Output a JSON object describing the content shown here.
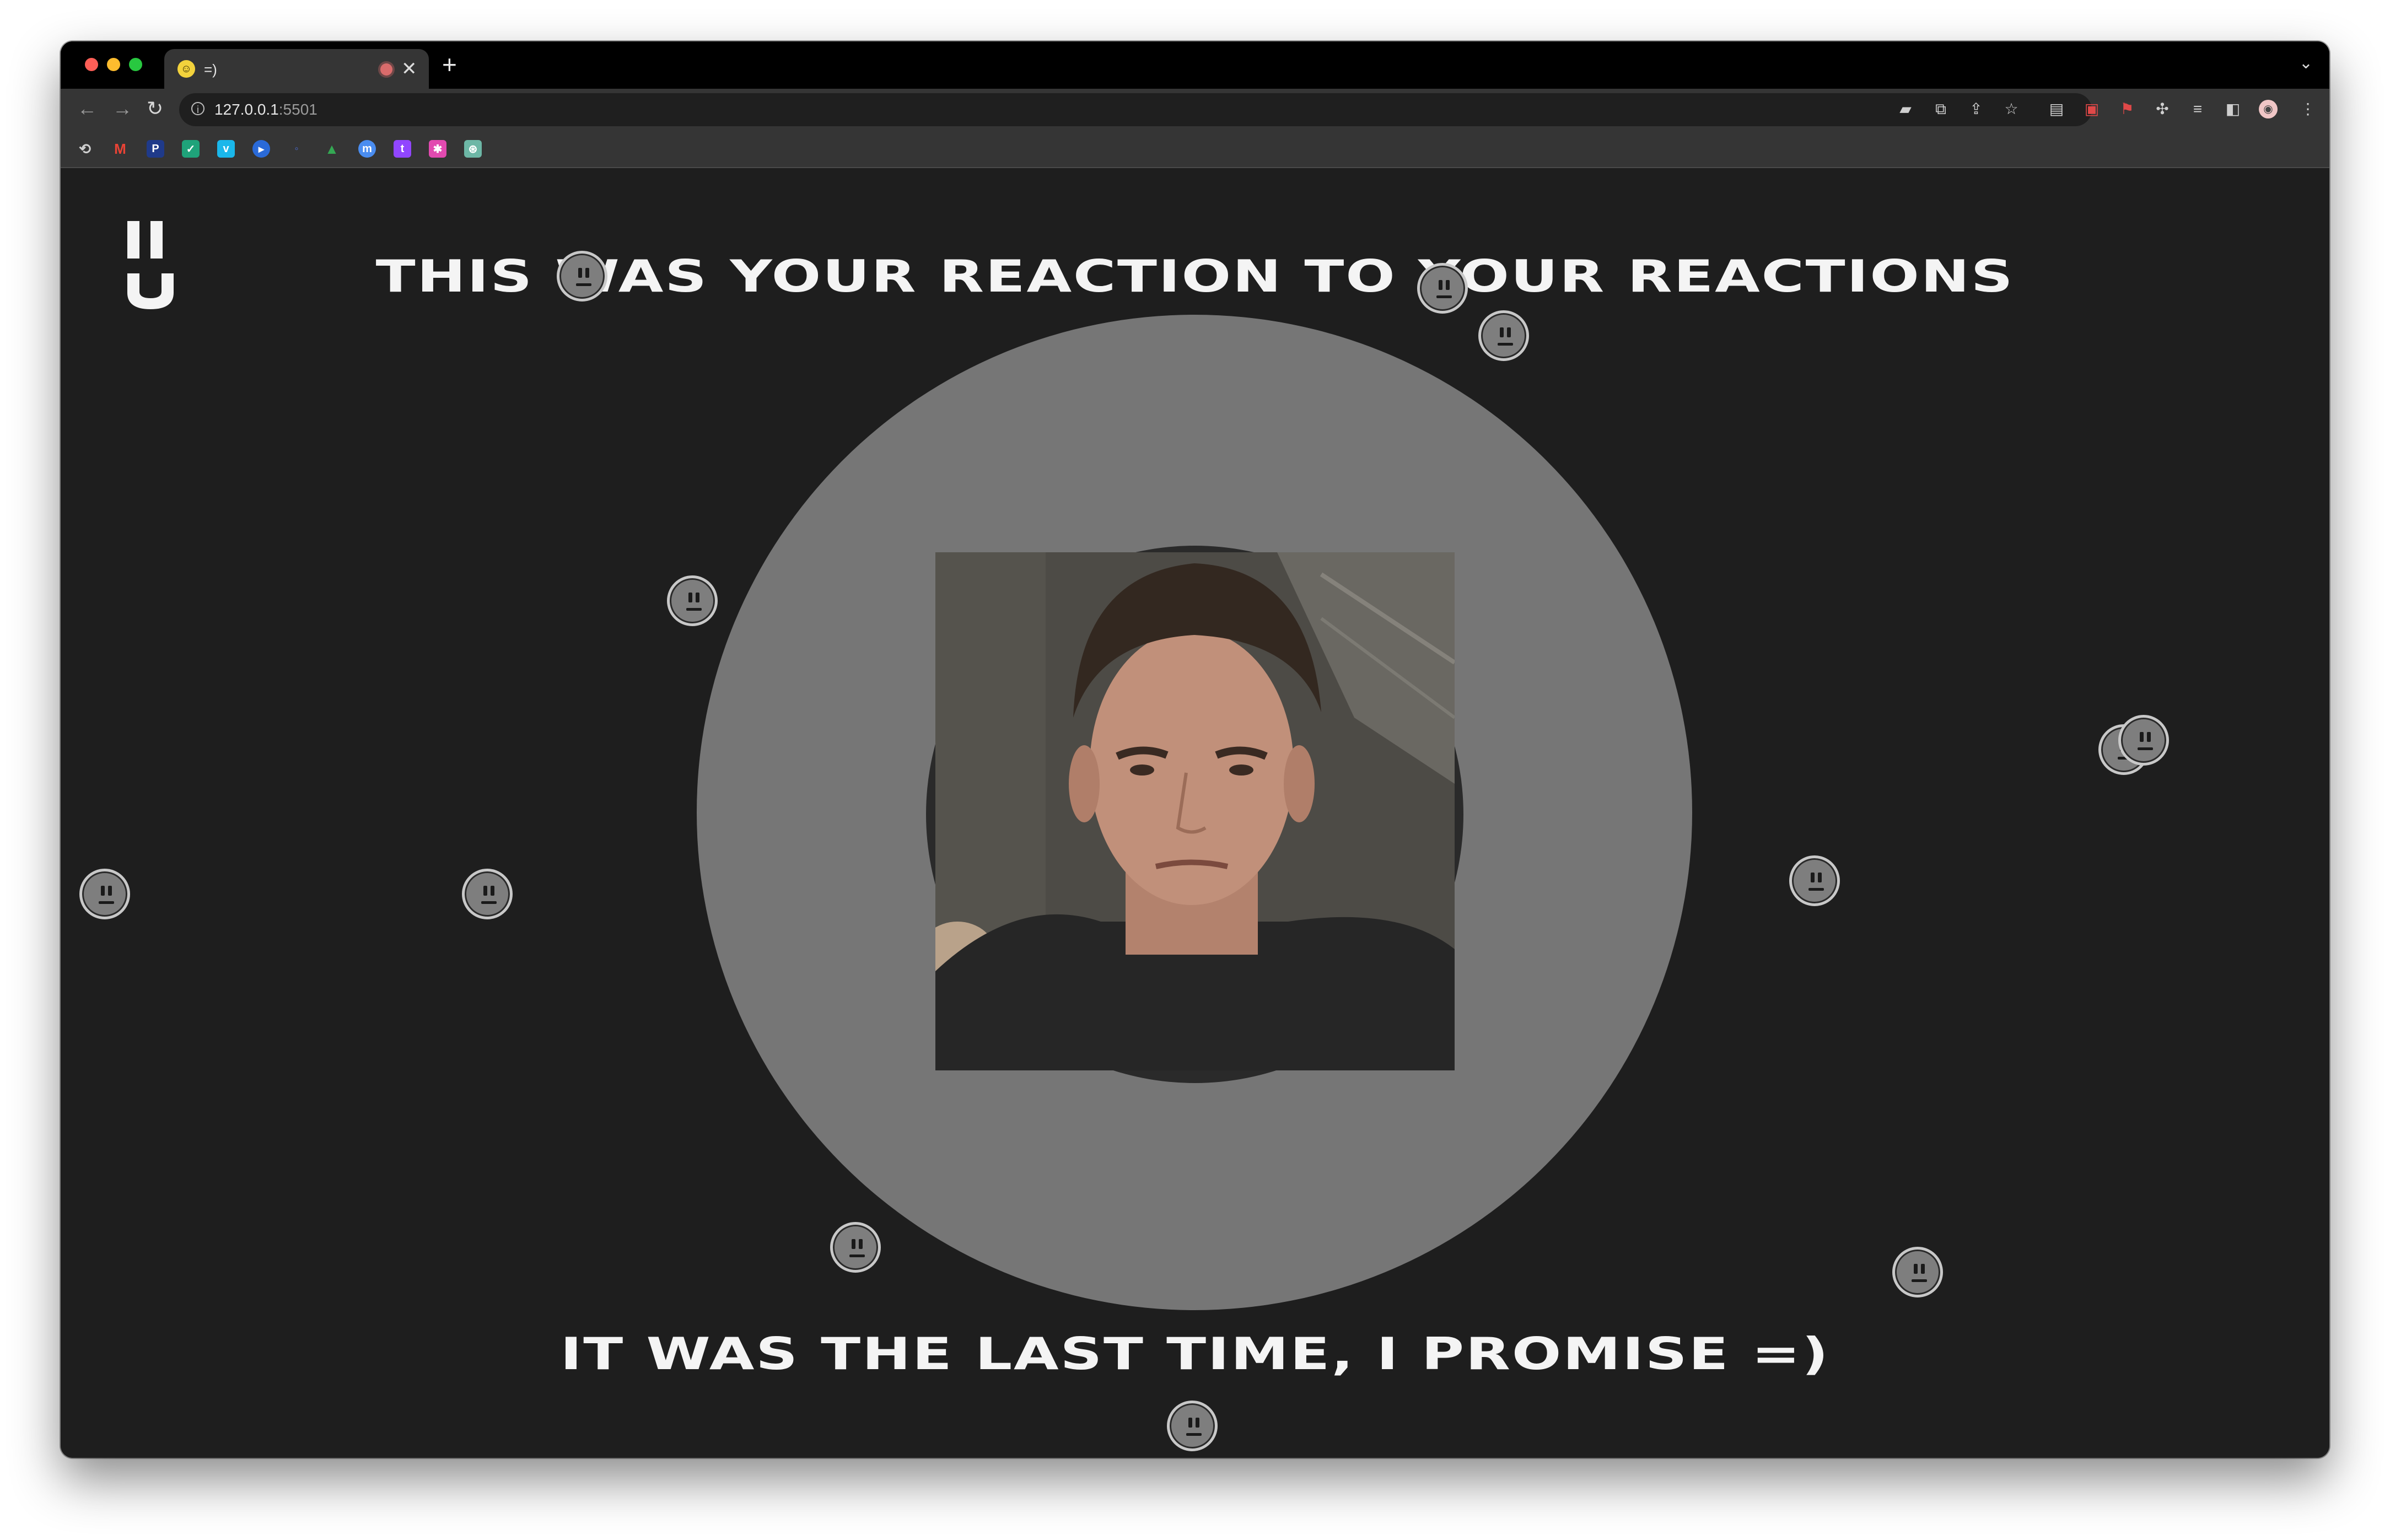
{
  "browser": {
    "tab": {
      "title": "=)",
      "favicon": "smiley-favicon"
    },
    "new_tab_symbol": "+",
    "close_symbol": "✕",
    "address": {
      "host": "127.0.0.1",
      "port": ":5501"
    },
    "icons": [
      "camera-icon",
      "translate-icon",
      "share-icon",
      "star-icon",
      "extension-icon",
      "extension-icon",
      "pdf-icon",
      "puzzle-icon",
      "media-icon",
      "sidebar-icon",
      "profile-avatar",
      "more-icon"
    ]
  },
  "page": {
    "heading_top": "THIS WAS YOUR REACTION TO YOUR REACTIONS",
    "heading_bottom": "IT WAS THE LAST TIME, I PROMISE =)",
    "logo": "logo-icon",
    "emoji_icon": "neutral-face-icon",
    "photo": "webcam-photo",
    "colors": {
      "background": "#1e1e1e",
      "circle": "#767676",
      "text": "#f4f4f4"
    }
  }
}
